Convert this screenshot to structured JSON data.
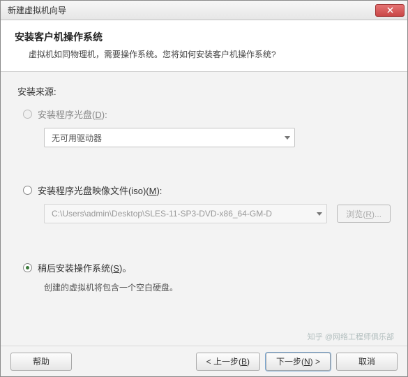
{
  "window": {
    "title": "新建虚拟机向导"
  },
  "header": {
    "title": "安装客户机操作系统",
    "subtitle": "虚拟机如同物理机，需要操作系统。您将如何安装客户机操作系统?"
  },
  "source": {
    "label": "安装来源:"
  },
  "options": {
    "disc": {
      "label_pre": "安装程序光盘(",
      "label_key": "D",
      "label_post": "):",
      "combo_text": "无可用驱动器"
    },
    "iso": {
      "label_pre": "安装程序光盘映像文件(iso)(",
      "label_key": "M",
      "label_post": "):",
      "path": "C:\\Users\\admin\\Desktop\\SLES-11-SP3-DVD-x86_64-GM-D",
      "browse_pre": "浏览(",
      "browse_key": "R",
      "browse_post": ")..."
    },
    "later": {
      "label_pre": "稍后安装操作系统(",
      "label_key": "S",
      "label_post": ")。",
      "hint": "创建的虚拟机将包含一个空白硬盘。"
    }
  },
  "footer": {
    "help": "帮助",
    "back_pre": "< 上一步(",
    "back_key": "B",
    "back_post": ")",
    "next_pre": "下一步(",
    "next_key": "N",
    "next_post": ") >",
    "cancel": "取消"
  },
  "watermark": "知乎 @网络工程师俱乐部"
}
